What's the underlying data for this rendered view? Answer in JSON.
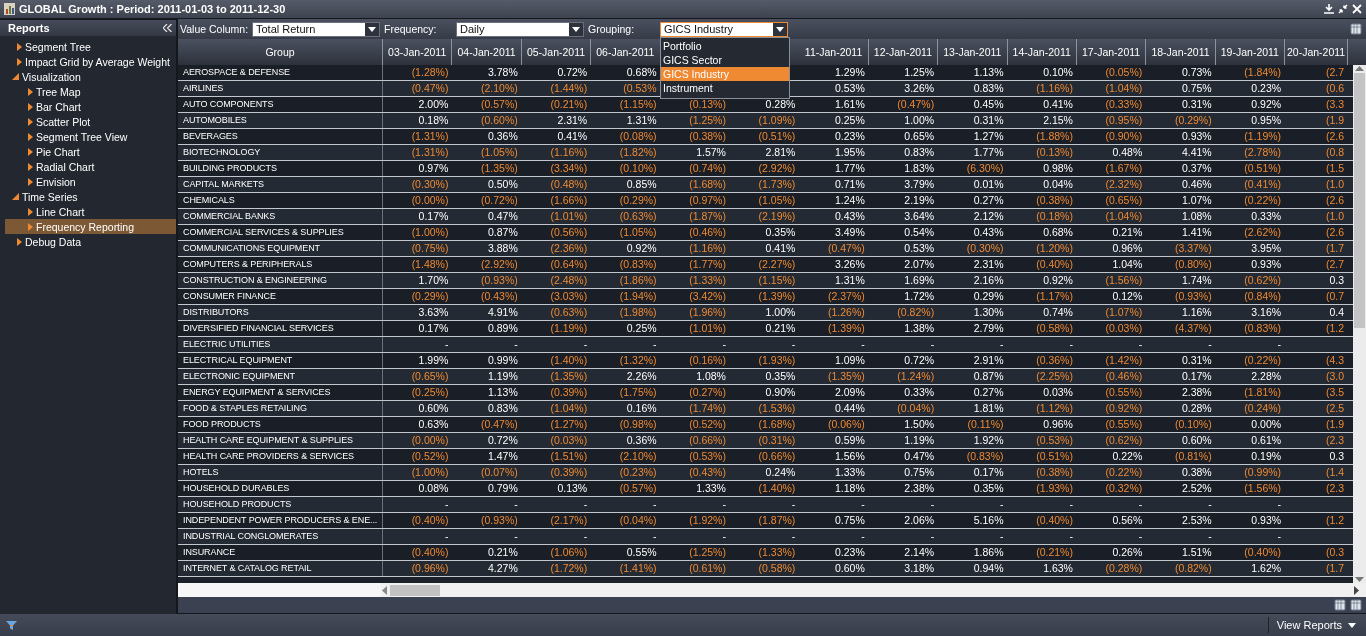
{
  "window": {
    "title": "GLOBAL Growth : Period: 2011-01-03 to 2011-12-30"
  },
  "sidebar": {
    "title": "Reports",
    "items": [
      {
        "label": "Segment Tree",
        "expanded": false,
        "selected": false
      },
      {
        "label": "Impact Grid by Average Weight",
        "expanded": false,
        "selected": false
      },
      {
        "label": "Visualization",
        "expanded": true,
        "selected": false,
        "children": [
          {
            "label": "Tree Map",
            "expanded": false,
            "selected": false
          },
          {
            "label": "Bar Chart",
            "expanded": false,
            "selected": false
          },
          {
            "label": "Scatter Plot",
            "expanded": false,
            "selected": false
          },
          {
            "label": "Segment Tree View",
            "expanded": false,
            "selected": false
          },
          {
            "label": "Pie Chart",
            "expanded": false,
            "selected": false
          },
          {
            "label": "Radial Chart",
            "expanded": false,
            "selected": false
          },
          {
            "label": "Envision",
            "expanded": false,
            "selected": false
          }
        ]
      },
      {
        "label": "Time Series",
        "expanded": true,
        "selected": false,
        "children": [
          {
            "label": "Line Chart",
            "expanded": false,
            "selected": false
          },
          {
            "label": "Frequency Reporting",
            "expanded": false,
            "selected": true
          }
        ]
      },
      {
        "label": "Debug Data",
        "expanded": false,
        "selected": false
      }
    ]
  },
  "toolbar": {
    "filters": [
      {
        "label": "Value Column:",
        "value": "Total Return",
        "focused": false
      },
      {
        "label": "Frequency:",
        "value": "Daily",
        "focused": false
      },
      {
        "label": "Grouping:",
        "value": "GICS Industry",
        "focused": true,
        "options": [
          {
            "label": "Portfolio",
            "selected": false
          },
          {
            "label": "GICS Sector",
            "selected": false
          },
          {
            "label": "GICS Industry",
            "selected": true
          },
          {
            "label": "Instrument",
            "selected": false
          }
        ]
      }
    ]
  },
  "table": {
    "columns": [
      "Group",
      "03-Jan-2011",
      "04-Jan-2011",
      "05-Jan-2011",
      "06-Jan-2011"
    ],
    "columns_after_menu": [
      "11-Jan-2011",
      "12-Jan-2011",
      "13-Jan-2011",
      "14-Jan-2011",
      "17-Jan-2011",
      "18-Jan-2011",
      "19-Jan-2011",
      "20-Jan-2011"
    ],
    "rows": [
      {
        "group": "AEROSPACE & DEFENSE",
        "values": [
          "(1.28%)",
          "3.78%",
          "0.72%",
          "0.68%"
        ],
        "values_after_menu": [
          "1.29%",
          "1.25%",
          "1.13%",
          "0.10%",
          "(0.05%)",
          "0.73%",
          "(1.84%)",
          "(2.7"
        ]
      },
      {
        "group": "AIRLINES",
        "values": [
          "(0.47%)",
          "(2.10%)",
          "(1.44%)",
          "(0.53%"
        ],
        "values_after_menu": [
          "0.53%",
          "3.26%",
          "0.83%",
          "(1.16%)",
          "(1.04%)",
          "0.75%",
          "0.23%",
          "(0.6"
        ]
      },
      {
        "group": "AUTO COMPONENTS",
        "values": [
          "2.00%",
          "(0.57%)",
          "(0.21%)",
          "(1.15%)",
          "(0.13%)",
          "0.28%",
          "1.61%",
          "(0.47%)",
          "0.45%",
          "0.41%",
          "(0.33%)",
          "0.31%",
          "0.92%",
          "(3.3"
        ]
      },
      {
        "group": "AUTOMOBILES",
        "values": [
          "0.18%",
          "(0.60%)",
          "2.31%",
          "1.31%",
          "(1.25%)",
          "(1.09%)",
          "0.25%",
          "1.00%",
          "0.31%",
          "2.15%",
          "(0.95%)",
          "(0.29%)",
          "0.95%",
          "(1.9"
        ]
      },
      {
        "group": "BEVERAGES",
        "values": [
          "(1.31%)",
          "0.36%",
          "0.41%",
          "(0.08%)",
          "(0.38%)",
          "(0.51%)",
          "0.23%",
          "0.65%",
          "1.27%",
          "(1.88%)",
          "(0.90%)",
          "0.93%",
          "(1.19%)",
          "(2.6"
        ]
      },
      {
        "group": "BIOTECHNOLOGY",
        "values": [
          "(1.31%)",
          "(1.05%)",
          "(1.16%)",
          "(1.82%)",
          "1.57%",
          "2.81%",
          "1.95%",
          "0.83%",
          "1.77%",
          "(0.13%)",
          "0.48%",
          "4.41%",
          "(2.78%)",
          "(0.8"
        ]
      },
      {
        "group": "BUILDING PRODUCTS",
        "values": [
          "0.97%",
          "(1.35%)",
          "(3.34%)",
          "(0.10%)",
          "(0.74%)",
          "(2.92%)",
          "1.77%",
          "1.83%",
          "(6.30%)",
          "0.98%",
          "(1.67%)",
          "0.37%",
          "(0.51%)",
          "(1.5"
        ]
      },
      {
        "group": "CAPITAL MARKETS",
        "values": [
          "(0.30%)",
          "0.50%",
          "(0.48%)",
          "0.85%",
          "(1.68%)",
          "(1.73%)",
          "0.71%",
          "3.79%",
          "0.01%",
          "0.04%",
          "(2.32%)",
          "0.46%",
          "(0.41%)",
          "(1.0"
        ]
      },
      {
        "group": "CHEMICALS",
        "values": [
          "(0.00%)",
          "(0.72%)",
          "(1.66%)",
          "(0.29%)",
          "(0.97%)",
          "(1.05%)",
          "1.24%",
          "2.19%",
          "0.27%",
          "(0.38%)",
          "(0.65%)",
          "1.07%",
          "(0.22%)",
          "(2.6"
        ]
      },
      {
        "group": "COMMERCIAL BANKS",
        "values": [
          "0.17%",
          "0.47%",
          "(1.01%)",
          "(0.63%)",
          "(1.87%)",
          "(2.19%)",
          "0.43%",
          "3.64%",
          "2.12%",
          "(0.18%)",
          "(1.04%)",
          "1.08%",
          "0.33%",
          "(1.0"
        ]
      },
      {
        "group": "COMMERCIAL SERVICES & SUPPLIES",
        "values": [
          "(1.00%)",
          "0.87%",
          "(0.56%)",
          "(1.05%)",
          "(0.46%)",
          "0.35%",
          "3.49%",
          "0.54%",
          "0.43%",
          "0.68%",
          "0.21%",
          "1.41%",
          "(2.62%)",
          "(2.6"
        ]
      },
      {
        "group": "COMMUNICATIONS EQUIPMENT",
        "values": [
          "(0.75%)",
          "3.88%",
          "(2.36%)",
          "0.92%",
          "(1.16%)",
          "0.41%",
          "(0.47%)",
          "0.53%",
          "(0.30%)",
          "(1.20%)",
          "0.96%",
          "(3.37%)",
          "3.95%",
          "(1.7"
        ]
      },
      {
        "group": "COMPUTERS & PERIPHERALS",
        "values": [
          "(1.48%)",
          "(2.92%)",
          "(0.64%)",
          "(0.83%)",
          "(1.77%)",
          "(2.27%)",
          "3.26%",
          "2.07%",
          "2.31%",
          "(0.40%)",
          "1.04%",
          "(0.80%)",
          "0.93%",
          "(2.7"
        ]
      },
      {
        "group": "CONSTRUCTION & ENGINEERING",
        "values": [
          "1.70%",
          "(0.93%)",
          "(2.48%)",
          "(1.86%)",
          "(1.33%)",
          "(1.15%)",
          "1.31%",
          "1.69%",
          "2.16%",
          "0.92%",
          "(1.56%)",
          "1.74%",
          "(0.62%)",
          "0.3"
        ]
      },
      {
        "group": "CONSUMER FINANCE",
        "values": [
          "(0.29%)",
          "(0.43%)",
          "(3.03%)",
          "(1.94%)",
          "(3.42%)",
          "(1.39%)",
          "(2.37%)",
          "1.72%",
          "0.29%",
          "(1.17%)",
          "0.12%",
          "(0.93%)",
          "(0.84%)",
          "(0.7"
        ]
      },
      {
        "group": "DISTRIBUTORS",
        "values": [
          "3.63%",
          "4.91%",
          "(0.63%)",
          "(1.98%)",
          "(1.96%)",
          "1.00%",
          "(1.26%)",
          "(0.82%)",
          "1.30%",
          "0.74%",
          "(1.07%)",
          "1.16%",
          "3.16%",
          "0.4"
        ]
      },
      {
        "group": "DIVERSIFIED FINANCIAL SERVICES",
        "values": [
          "0.17%",
          "0.89%",
          "(1.19%)",
          "0.25%",
          "(1.01%)",
          "0.21%",
          "(1.39%)",
          "1.38%",
          "2.79%",
          "(0.58%)",
          "(0.03%)",
          "(4.37%)",
          "(0.83%)",
          "(1.2"
        ]
      },
      {
        "group": "ELECTRIC UTILITIES",
        "values": [
          "-",
          "-",
          "-",
          "-",
          "-",
          "-",
          "-",
          "-",
          "-",
          "-",
          "-",
          "-",
          "-"
        ]
      },
      {
        "group": "ELECTRICAL EQUIPMENT",
        "values": [
          "1.99%",
          "0.99%",
          "(1.40%)",
          "(1.32%)",
          "(0.16%)",
          "(1.93%)",
          "1.09%",
          "0.72%",
          "2.91%",
          "(0.36%)",
          "(1.42%)",
          "0.31%",
          "(0.22%)",
          "(4.3"
        ]
      },
      {
        "group": "ELECTRONIC EQUIPMENT",
        "values": [
          "(0.65%)",
          "1.19%",
          "(1.35%)",
          "2.26%",
          "1.08%",
          "0.35%",
          "(1.35%)",
          "(1.24%)",
          "0.87%",
          "(2.25%)",
          "(0.46%)",
          "0.17%",
          "2.28%",
          "(3.0"
        ]
      },
      {
        "group": "ENERGY EQUIPMENT & SERVICES",
        "values": [
          "(0.25%)",
          "1.13%",
          "(0.39%)",
          "(1.75%)",
          "(0.27%)",
          "0.90%",
          "2.09%",
          "0.33%",
          "0.27%",
          "0.03%",
          "(0.55%)",
          "2.38%",
          "(1.81%)",
          "(3.5"
        ]
      },
      {
        "group": "FOOD & STAPLES RETAILING",
        "values": [
          "0.60%",
          "0.83%",
          "(1.04%)",
          "0.16%",
          "(1.74%)",
          "(1.53%)",
          "0.44%",
          "(0.04%)",
          "1.81%",
          "(1.12%)",
          "(0.92%)",
          "0.28%",
          "(0.24%)",
          "(2.5"
        ]
      },
      {
        "group": "FOOD PRODUCTS",
        "values": [
          "0.63%",
          "(0.47%)",
          "(1.27%)",
          "(0.98%)",
          "(0.52%)",
          "(1.68%)",
          "(0.06%)",
          "1.50%",
          "(0.11%)",
          "0.96%",
          "(0.55%)",
          "(0.10%)",
          "0.00%",
          "(1.9"
        ]
      },
      {
        "group": "HEALTH CARE EQUIPMENT & SUPPLIES",
        "values": [
          "(0.00%)",
          "0.72%",
          "(0.03%)",
          "0.36%",
          "(0.66%)",
          "(0.31%)",
          "0.59%",
          "1.19%",
          "1.92%",
          "(0.53%)",
          "(0.62%)",
          "0.60%",
          "0.61%",
          "(2.3"
        ]
      },
      {
        "group": "HEALTH CARE PROVIDERS & SERVICES",
        "values": [
          "(0.52%)",
          "1.47%",
          "(1.51%)",
          "(2.10%)",
          "(0.53%)",
          "(0.66%)",
          "1.56%",
          "0.47%",
          "(0.83%)",
          "(0.51%)",
          "0.22%",
          "(0.81%)",
          "0.19%",
          "0.3"
        ]
      },
      {
        "group": "HOTELS",
        "values": [
          "(1.00%)",
          "(0.07%)",
          "(0.39%)",
          "(0.23%)",
          "(0.43%)",
          "0.24%",
          "1.33%",
          "0.75%",
          "0.17%",
          "(0.38%)",
          "(0.22%)",
          "0.38%",
          "(0.99%)",
          "(1.4"
        ]
      },
      {
        "group": "HOUSEHOLD DURABLES",
        "values": [
          "0.08%",
          "0.79%",
          "0.13%",
          "(0.57%)",
          "1.33%",
          "(1.40%)",
          "1.18%",
          "2.38%",
          "0.35%",
          "(1.93%)",
          "(0.32%)",
          "2.52%",
          "(1.56%)",
          "(2.3"
        ]
      },
      {
        "group": "HOUSEHOLD PRODUCTS",
        "values": [
          "-",
          "-",
          "-",
          "-",
          "-",
          "-",
          "-",
          "-",
          "-",
          "-",
          "-",
          "-",
          "-"
        ]
      },
      {
        "group": "INDEPENDENT POWER PRODUCERS & ENE...",
        "values": [
          "(0.40%)",
          "(0.93%)",
          "(2.17%)",
          "(0.04%)",
          "(1.92%)",
          "(1.87%)",
          "0.75%",
          "2.06%",
          "5.16%",
          "(0.40%)",
          "0.56%",
          "2.53%",
          "0.93%",
          "(1.2"
        ]
      },
      {
        "group": "INDUSTRIAL CONGLOMERATES",
        "values": [
          "-",
          "-",
          "-",
          "-",
          "-",
          "-",
          "-",
          "-",
          "-",
          "-",
          "-",
          "-",
          "-"
        ]
      },
      {
        "group": "INSURANCE",
        "values": [
          "(0.40%)",
          "0.21%",
          "(1.06%)",
          "0.55%",
          "(1.25%)",
          "(1.33%)",
          "0.23%",
          "2.14%",
          "1.86%",
          "(0.21%)",
          "0.26%",
          "1.51%",
          "(0.40%)",
          "(0.3"
        ]
      },
      {
        "group": "INTERNET & CATALOG RETAIL",
        "values": [
          "(0.96%)",
          "4.27%",
          "(1.72%)",
          "(1.41%)",
          "(0.61%)",
          "(0.58%)",
          "0.60%",
          "3.18%",
          "0.94%",
          "1.63%",
          "(0.28%)",
          "(0.82%)",
          "1.62%",
          "(1.7"
        ]
      }
    ]
  },
  "status_bar": {
    "menu": "View Reports"
  }
}
